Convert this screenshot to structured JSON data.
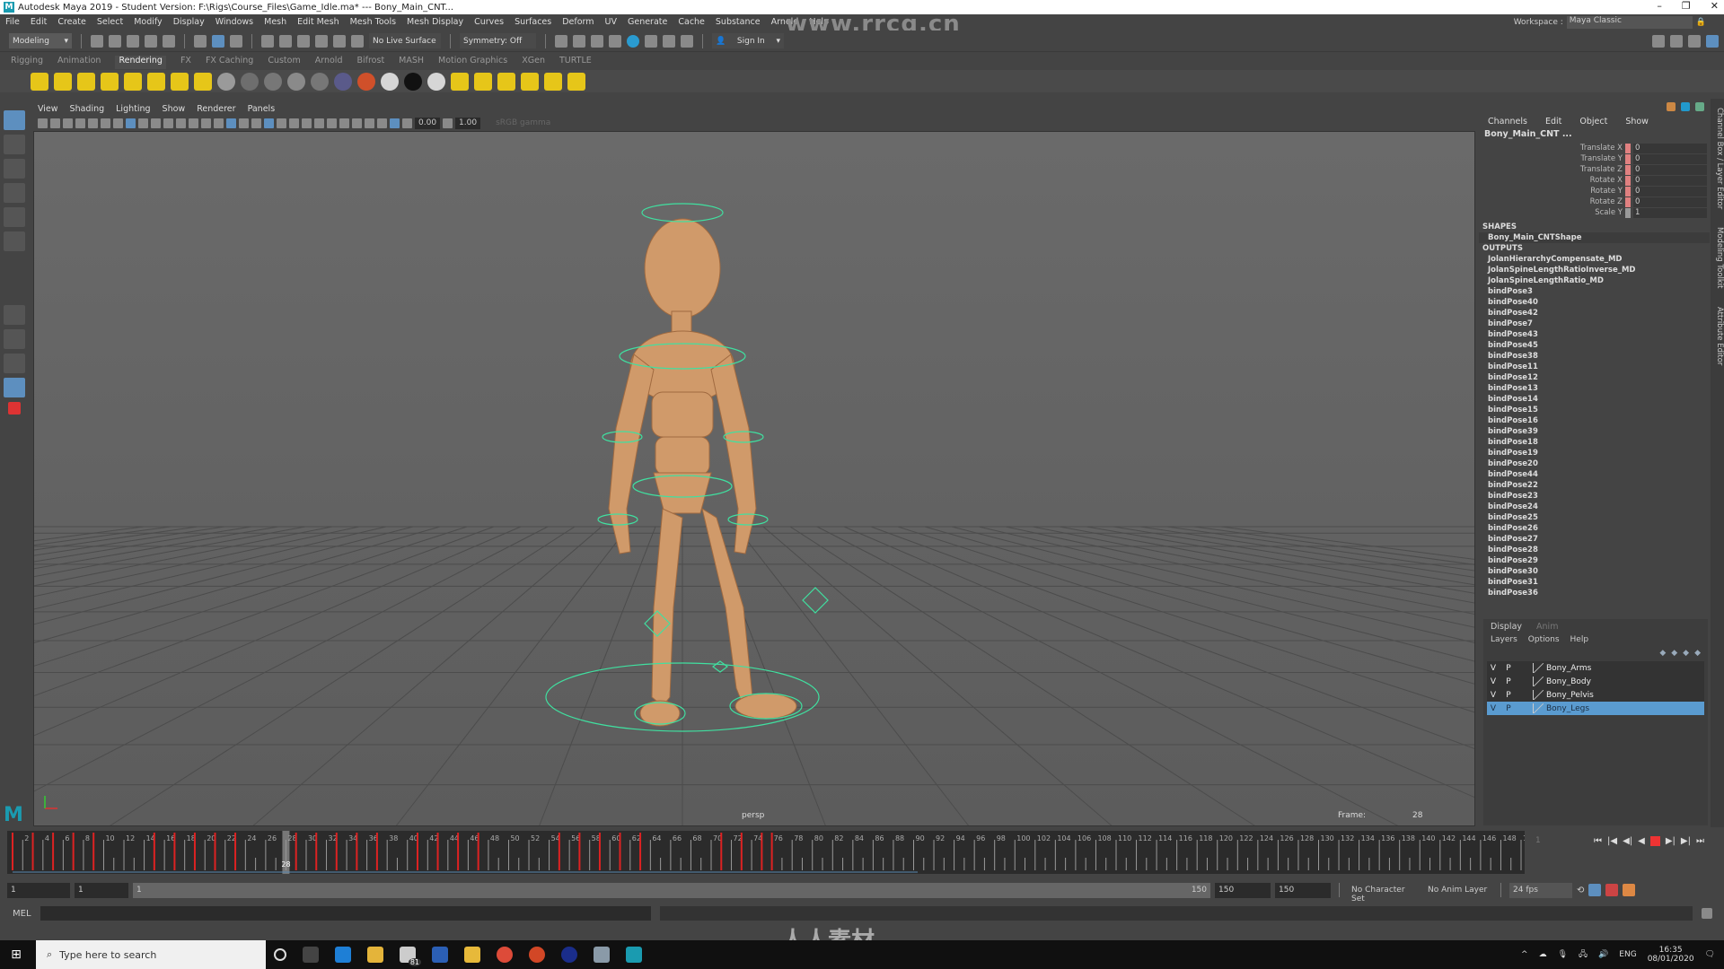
{
  "window": {
    "title": "Autodesk Maya 2019 - Student Version: F:\\Rigs\\Course_Files\\Game_Idle.ma*  ---  Bony_Main_CNT...",
    "controls": [
      "–",
      "❐",
      "✕"
    ]
  },
  "watermark": "www.rrcg.cn",
  "watermark_bottom": "人人素材",
  "menu": [
    "File",
    "Edit",
    "Create",
    "Select",
    "Modify",
    "Display",
    "Windows",
    "Mesh",
    "Edit Mesh",
    "Mesh Tools",
    "Mesh Display",
    "Curves",
    "Surfaces",
    "Deform",
    "UV",
    "Generate",
    "Cache",
    "Substance",
    "Arnold",
    "Help"
  ],
  "workspace": {
    "label": "Workspace :",
    "value": "Maya Classic"
  },
  "status": {
    "mode": "Modeling",
    "live_surface": "No Live Surface",
    "symmetry": "Symmetry: Off",
    "sign_in": "Sign In"
  },
  "shelf_tabs": [
    "Rigging",
    "Animation",
    "Rendering",
    "FX",
    "FX Caching",
    "Custom",
    "Arnold",
    "Bifrost",
    "MASH",
    "Motion Graphics",
    "XGen",
    "TURTLE"
  ],
  "shelf_active": "Rendering",
  "shelf_icon_colors": [
    "#e6c619",
    "#e6c619",
    "#e6c619",
    "#e6c619",
    "#e6c619",
    "#e6c619",
    "#e6c619",
    "#e6c619",
    "#9a9a9a",
    "#6e6e6e",
    "#777",
    "#8a8a8a",
    "#777",
    "#5a5a8a",
    "#d0502a",
    "#d6d6d6",
    "#111111",
    "#d6d6d6",
    "#e6c619",
    "#e6c619",
    "#e6c619",
    "#e6c619",
    "#e6c619",
    "#e6c619"
  ],
  "panel_menu": [
    "View",
    "Shading",
    "Lighting",
    "Show",
    "Renderer",
    "Panels"
  ],
  "panel_tools": {
    "exposure": "0.00",
    "gamma": "1.00",
    "color_space": "sRGB gamma"
  },
  "viewport": {
    "camera": "persp",
    "frame_label": "Frame:",
    "frame_value": "28",
    "accent_color": "#40e0a0"
  },
  "channel_box": {
    "menu": [
      "Channels",
      "Edit",
      "Object",
      "Show"
    ],
    "object": "Bony_Main_CNT ...",
    "attributes": [
      {
        "name": "Translate X",
        "value": "0"
      },
      {
        "name": "Translate Y",
        "value": "0"
      },
      {
        "name": "Translate Z",
        "value": "0"
      },
      {
        "name": "Rotate X",
        "value": "0"
      },
      {
        "name": "Rotate Y",
        "value": "0"
      },
      {
        "name": "Rotate Z",
        "value": "0"
      },
      {
        "name": "Scale Y",
        "value": "1"
      }
    ],
    "shapes_header": "SHAPES",
    "shape": "Bony_Main_CNTShape",
    "outputs_header": "OUTPUTS",
    "outputs": [
      "JolanHierarchyCompensate_MD",
      "JolanSpineLengthRatioInverse_MD",
      "JolanSpineLengthRatio_MD",
      "bindPose3",
      "bindPose40",
      "bindPose42",
      "bindPose7",
      "bindPose43",
      "bindPose45",
      "bindPose38",
      "bindPose11",
      "bindPose12",
      "bindPose13",
      "bindPose14",
      "bindPose15",
      "bindPose16",
      "bindPose39",
      "bindPose18",
      "bindPose19",
      "bindPose20",
      "bindPose44",
      "bindPose22",
      "bindPose23",
      "bindPose24",
      "bindPose25",
      "bindPose26",
      "bindPose27",
      "bindPose28",
      "bindPose29",
      "bindPose30",
      "bindPose31",
      "bindPose36"
    ]
  },
  "side_tabs": [
    "Channel Box / Layer Editor",
    "Modeling Toolkit",
    "Attribute Editor"
  ],
  "layer_editor": {
    "tabs": [
      "Display",
      "Anim"
    ],
    "menu": [
      "Layers",
      "Options",
      "Help"
    ],
    "layers": [
      {
        "v": "V",
        "p": "P",
        "name": "Bony_Arms",
        "selected": false
      },
      {
        "v": "V",
        "p": "P",
        "name": "Bony_Body",
        "selected": false
      },
      {
        "v": "V",
        "p": "P",
        "name": "Bony_Pelvis",
        "selected": false
      },
      {
        "v": "V",
        "p": "P",
        "name": "Bony_Legs",
        "selected": true
      }
    ]
  },
  "timeline": {
    "start": 1,
    "end": 150,
    "current": 28,
    "current_label": "28",
    "keyframes": [
      1,
      3,
      5,
      7,
      9,
      15,
      17,
      19,
      21,
      23,
      29,
      31,
      33,
      35,
      37,
      41,
      43,
      45,
      47,
      55,
      57,
      59,
      61,
      63,
      71,
      73,
      75,
      76
    ],
    "right_label": "1"
  },
  "range": {
    "start": "1",
    "playback_start": "1",
    "slider_start": "1",
    "slider_end": "150",
    "playback_end": "150",
    "end": "150",
    "character_set": "No Character Set",
    "anim_layer": "No Anim Layer",
    "fps": "24 fps"
  },
  "playback_controls": [
    "⏮",
    "|◀",
    "◀|",
    "◀",
    "■",
    "▶|",
    "▶|",
    "⏭"
  ],
  "command_line": {
    "label": "MEL"
  },
  "taskbar": {
    "search_placeholder": "Type here to search",
    "mail_badge": "81",
    "language": "ENG",
    "time": "16:35",
    "date": "08/01/2020"
  }
}
